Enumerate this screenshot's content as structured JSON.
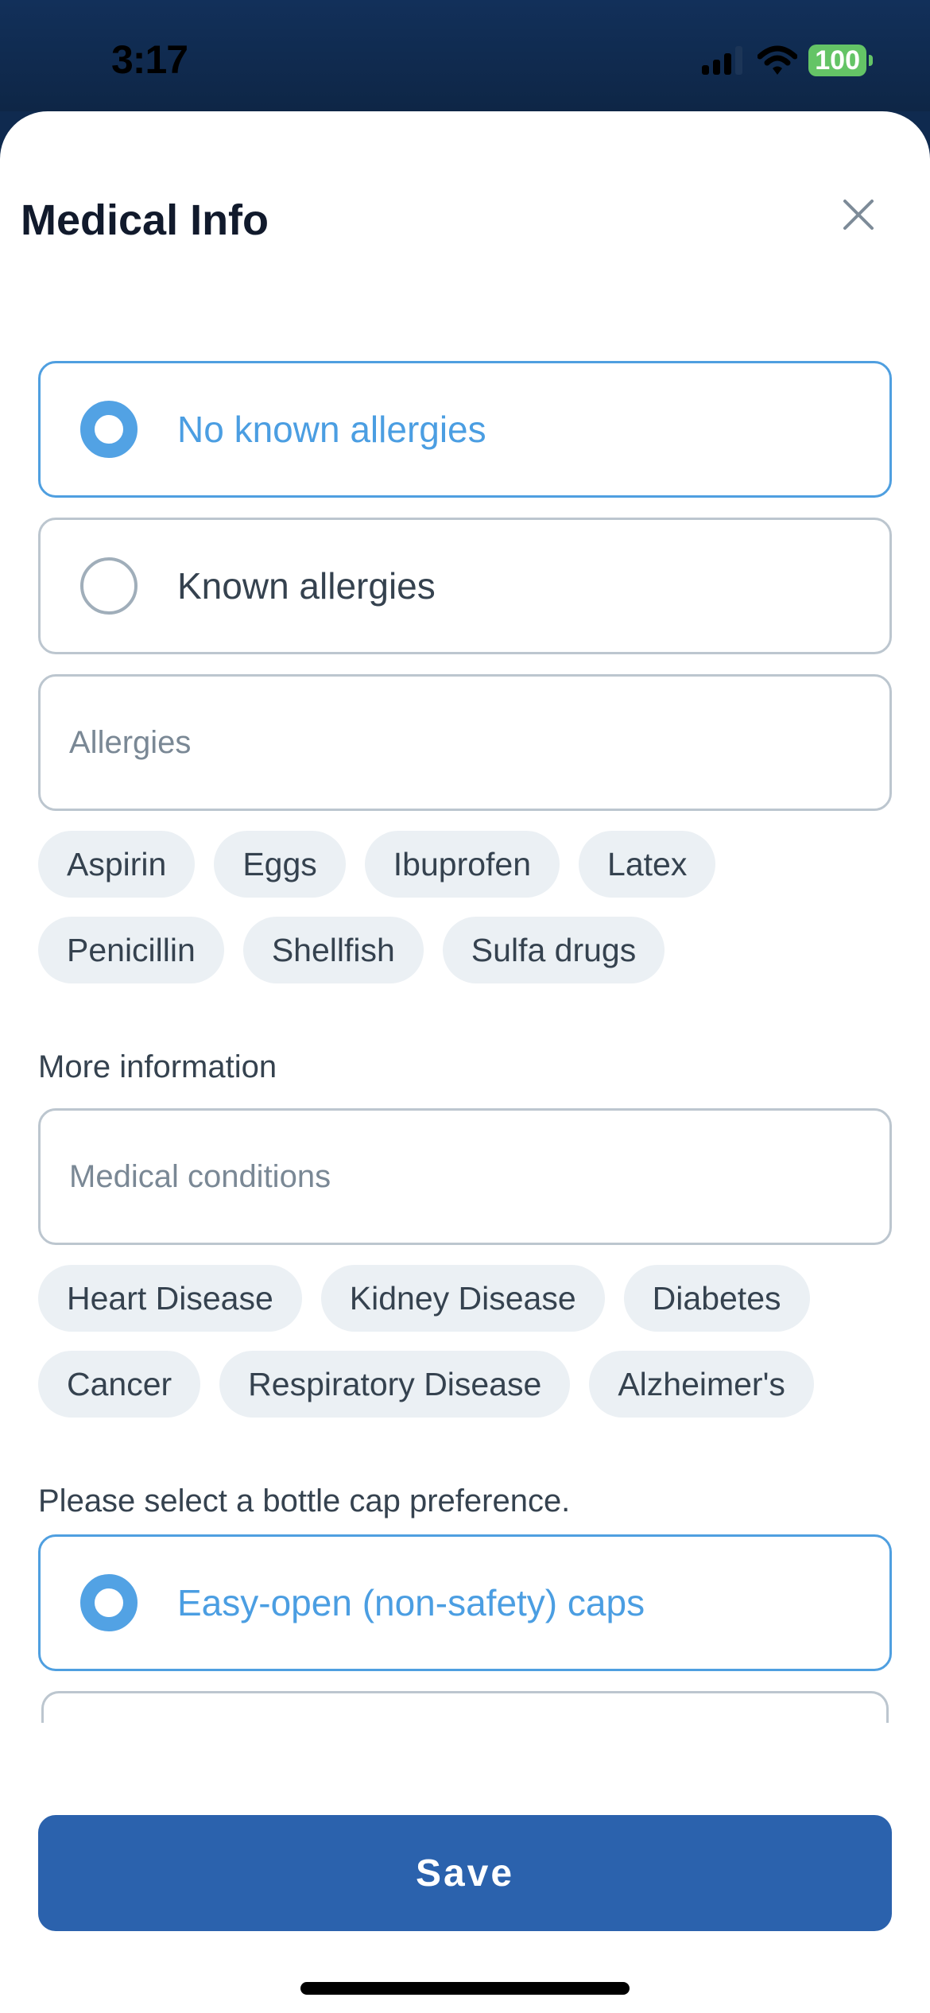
{
  "status_bar": {
    "time": "3:17",
    "battery": "100",
    "icons": [
      "signal-icon",
      "wifi-icon",
      "battery-icon"
    ]
  },
  "header": {
    "title": "Medical Info",
    "close_icon": "close-icon"
  },
  "allergy_options": [
    {
      "label": "No known allergies",
      "selected": true
    },
    {
      "label": "Known allergies",
      "selected": false
    }
  ],
  "allergies_field": {
    "placeholder": "Allergies",
    "value": ""
  },
  "allergy_chips": [
    "Aspirin",
    "Eggs",
    "Ibuprofen",
    "Latex",
    "Penicillin",
    "Shellfish",
    "Sulfa drugs"
  ],
  "more_info": {
    "label": "More information",
    "conditions_field": {
      "placeholder": "Medical conditions",
      "value": ""
    },
    "condition_chips": [
      "Heart Disease",
      "Kidney Disease",
      "Diabetes",
      "Cancer",
      "Respiratory Disease",
      "Alzheimer's"
    ]
  },
  "cap_preference": {
    "label": "Please select a bottle cap preference.",
    "options": [
      {
        "label": "Easy-open (non-safety) caps",
        "selected": true
      }
    ]
  },
  "footer": {
    "save_label": "Save"
  },
  "colors": {
    "accent": "#52a2e4",
    "primary_button": "#2b62ad",
    "header_bg": "#0f2a4f",
    "chip_bg": "#ebf0f4",
    "battery": "#64c466"
  }
}
